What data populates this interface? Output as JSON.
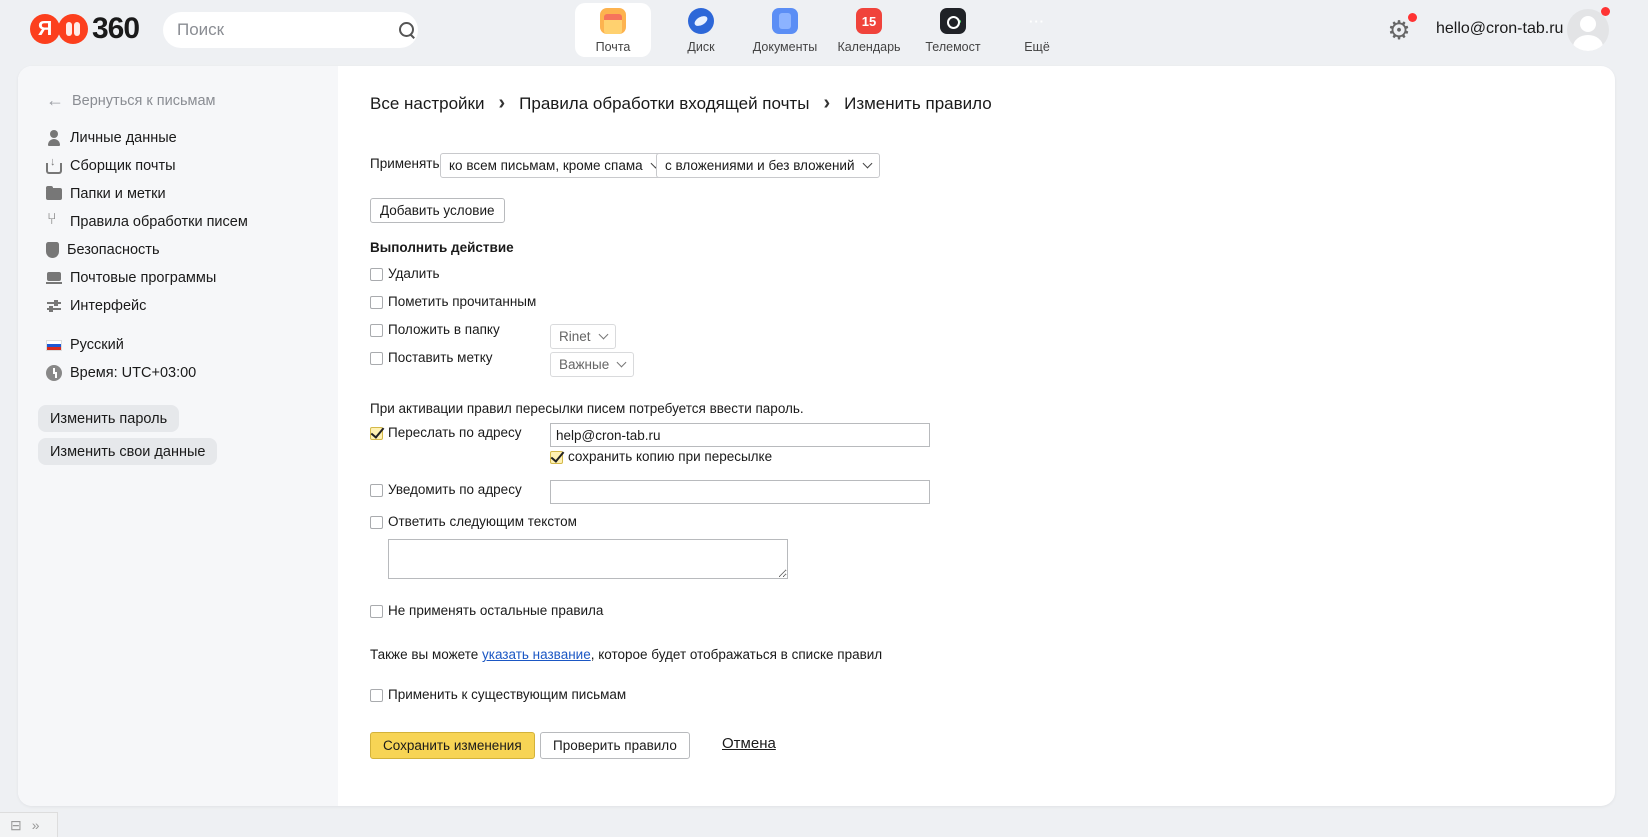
{
  "header": {
    "logo_text": "360",
    "logo_letter": "Я",
    "search_placeholder": "Поиск",
    "apps": [
      {
        "label": "Почта",
        "icon": "mail-icon"
      },
      {
        "label": "Диск",
        "icon": "disk-icon"
      },
      {
        "label": "Документы",
        "icon": "docs-icon"
      },
      {
        "label": "Календарь",
        "icon": "calendar-icon",
        "badge": "15"
      },
      {
        "label": "Телемост",
        "icon": "telemost-icon"
      },
      {
        "label": "Ещё",
        "icon": "more-icon",
        "glyph": "···"
      }
    ],
    "user_email": "hello@cron-tab.ru"
  },
  "sidebar": {
    "back_label": "Вернуться к письмам",
    "items": [
      {
        "label": "Личные данные"
      },
      {
        "label": "Сборщик почты"
      },
      {
        "label": "Папки и метки"
      },
      {
        "label": "Правила обработки писем"
      },
      {
        "label": "Безопасность"
      },
      {
        "label": "Почтовые программы"
      },
      {
        "label": "Интерфейс"
      }
    ],
    "language": "Русский",
    "time": "Время: UTC+03:00",
    "change_password": "Изменить пароль",
    "change_data": "Изменить свои данные"
  },
  "breadcrumbs": [
    "Все настройки",
    "Правила обработки входящей почты",
    "Изменить правило"
  ],
  "form": {
    "apply_label": "Применять",
    "apply_scope": "ко всем письмам, кроме спама",
    "apply_attachments": "с вложениями и без вложений",
    "add_condition": "Добавить условие",
    "action_heading": "Выполнить действие",
    "delete_label": "Удалить",
    "mark_read_label": "Пометить прочитанным",
    "move_folder_label": "Положить в папку",
    "folder_value": "Rinet",
    "set_label_label": "Поставить метку",
    "label_value": "Важные",
    "forward_note": "При активации правил пересылки писем потребуется ввести пароль.",
    "forward_label": "Переслать по адресу",
    "forward_value": "help@cron-tab.ru",
    "keep_copy_label": "сохранить копию при пересылке",
    "notify_label": "Уведомить по адресу",
    "notify_value": "",
    "reply_label": "Ответить следующим текстом",
    "reply_text": "",
    "stop_rules_label": "Не применять остальные правила",
    "name_hint_before": "Также вы можете ",
    "name_hint_link": "указать название",
    "name_hint_after": ", которое будет отображаться в списке правил",
    "apply_existing_label": "Применить к существующим письмам",
    "save_button": "Сохранить изменения",
    "check_button": "Проверить правило",
    "cancel": "Отмена",
    "checked": {
      "delete": false,
      "mark_read": false,
      "move_folder": false,
      "set_label": false,
      "forward": true,
      "keep_copy": true,
      "notify": false,
      "reply": false,
      "stop_rules": false,
      "apply_existing": false
    }
  },
  "colors": {
    "accent_yellow": "#f7d455",
    "link_blue": "#1b57c4",
    "brand_red": "#fc3f1d"
  }
}
